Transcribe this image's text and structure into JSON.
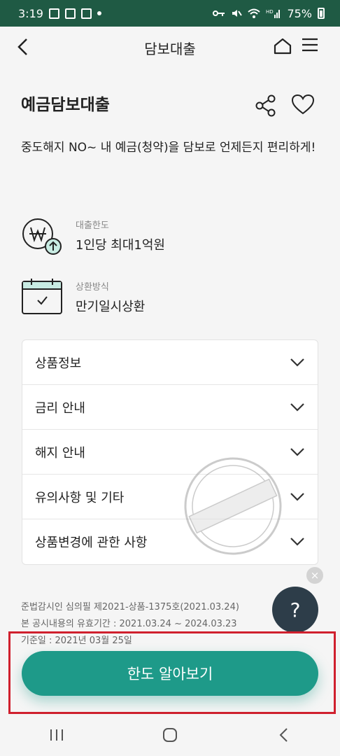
{
  "status_bar": {
    "time": "3:19",
    "battery": "75%"
  },
  "header": {
    "title": "담보대출"
  },
  "product": {
    "title": "예금담보대출",
    "description": "중도해지 NO~ 내 예금(청약)을 담보로 언제든지 편리하게!"
  },
  "info": [
    {
      "label": "대출한도",
      "value": "1인당 최대1억원",
      "icon": "won-up-icon"
    },
    {
      "label": "상환방식",
      "value": "만기일시상환",
      "icon": "calendar-check-icon"
    }
  ],
  "accordion": [
    {
      "label": "상품정보"
    },
    {
      "label": "금리 안내"
    },
    {
      "label": "해지 안내"
    },
    {
      "label": "유의사항 및 기타"
    },
    {
      "label": "상품변경에 관한 사항"
    }
  ],
  "notice": {
    "line1": "준법감시인 심의필 제2021-상품-1375호(2021.03.24)",
    "line2": "본 공시내용의 유효기간 : 2021.03.24 ~ 2024.03.23",
    "line3": "기준일 : 2021년 03월 25일"
  },
  "help": {
    "label": "?",
    "close": "×"
  },
  "cta": {
    "label": "한도 알아보기"
  },
  "colors": {
    "accent": "#1e9a89",
    "status_bar": "#1f5a44",
    "highlight": "#d0202e",
    "help_bg": "#2d3d49"
  }
}
